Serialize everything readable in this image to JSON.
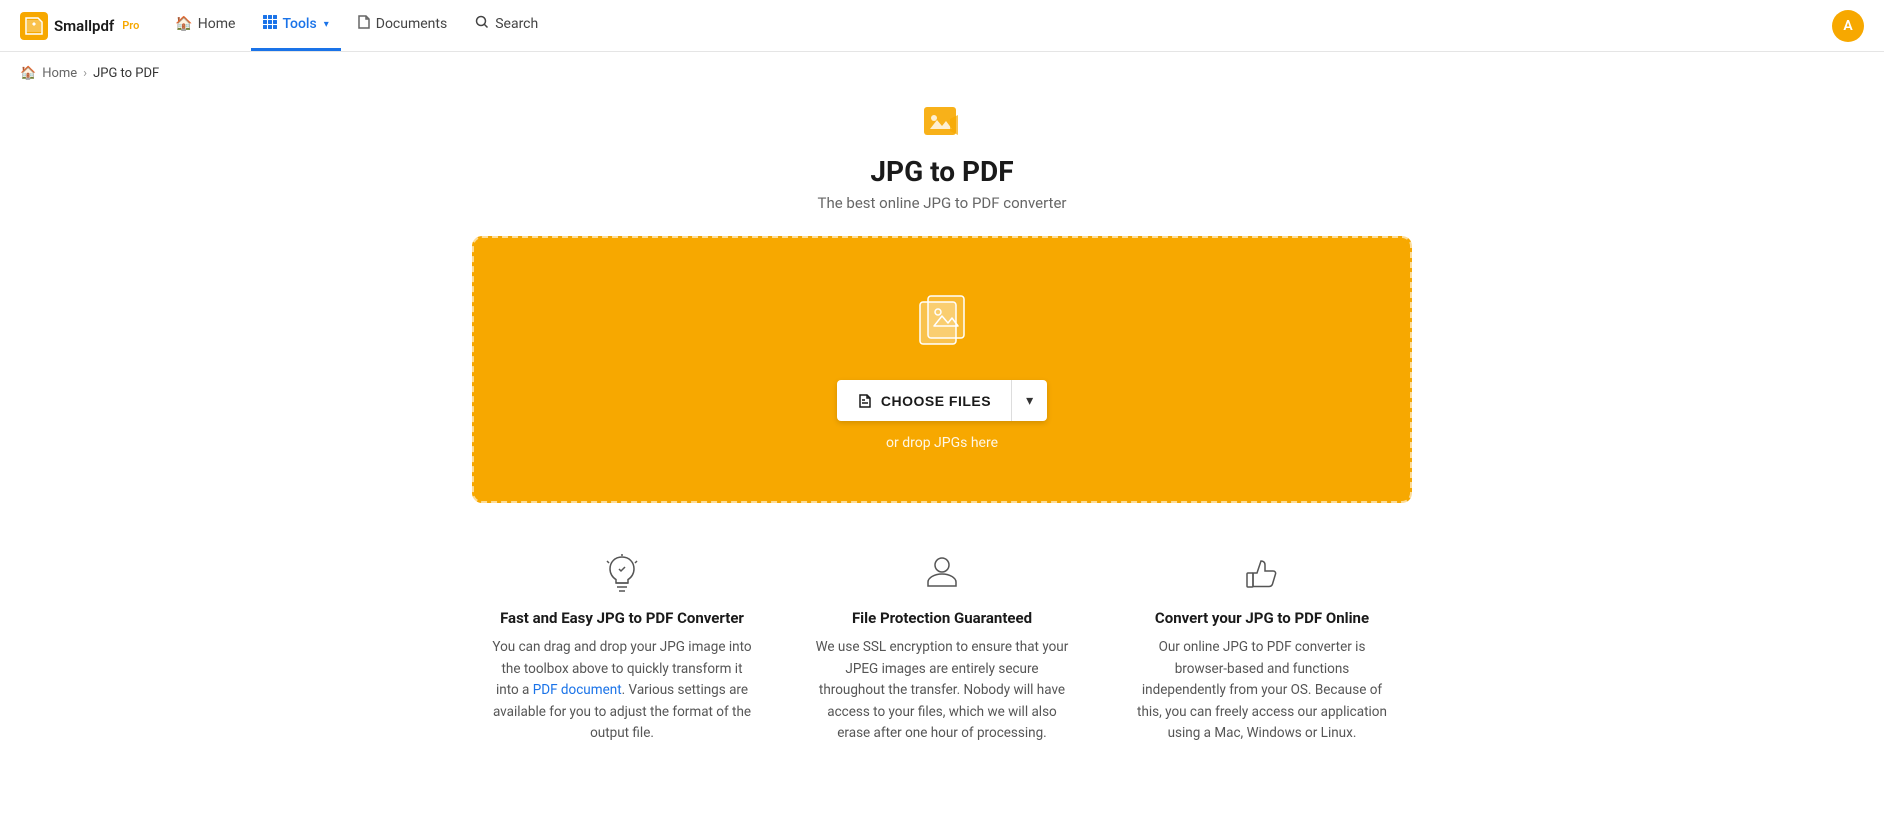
{
  "header": {
    "logo_text": "Smallpdf",
    "pro_label": "Pro",
    "nav": [
      {
        "id": "home",
        "label": "Home",
        "icon": "🏠",
        "active": false
      },
      {
        "id": "tools",
        "label": "Tools",
        "icon": "⊞",
        "active": true,
        "has_dropdown": true
      },
      {
        "id": "documents",
        "label": "Documents",
        "icon": "📄",
        "active": false
      },
      {
        "id": "search",
        "label": "Search",
        "icon": "🔍",
        "active": false
      }
    ],
    "avatar_initials": "A"
  },
  "breadcrumb": {
    "home_label": "Home",
    "current_label": "JPG to PDF"
  },
  "page": {
    "title": "JPG to PDF",
    "subtitle": "The best online JPG to PDF converter"
  },
  "drop_zone": {
    "choose_files_label": "CHOOSE FILES",
    "drop_hint": "or drop JPGs here"
  },
  "features": [
    {
      "id": "fast-easy",
      "title": "Fast and Easy JPG to PDF Converter",
      "description": "You can drag and drop your JPG image into the toolbox above to quickly transform it into a PDF document. Various settings are available for you to adjust the format of the output file."
    },
    {
      "id": "file-protection",
      "title": "File Protection Guaranteed",
      "description": "We use SSL encryption to ensure that your JPEG images are entirely secure throughout the transfer. Nobody will have access to your files, which we will also erase after one hour of processing."
    },
    {
      "id": "online-convert",
      "title": "Convert your JPG to PDF Online",
      "description": "Our online JPG to PDF converter is browser-based and functions independently from your OS. Because of this, you can freely access our application using a Mac, Windows or Linux."
    }
  ]
}
